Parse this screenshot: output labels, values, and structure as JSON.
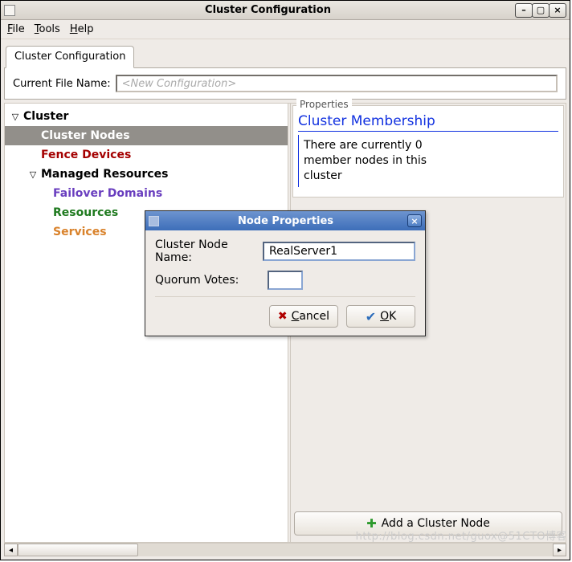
{
  "window": {
    "title": "Cluster Configuration"
  },
  "menubar": {
    "file": "File",
    "tools": "Tools",
    "help": "Help"
  },
  "notebook": {
    "tab_label": "Cluster Configuration",
    "current_file_label": "Current File Name:",
    "current_file_placeholder": "<New Configuration>"
  },
  "tree": {
    "cluster": "Cluster",
    "cluster_nodes": "Cluster Nodes",
    "fence_devices": "Fence Devices",
    "managed_resources": "Managed Resources",
    "failover_domains": "Failover Domains",
    "resources": "Resources",
    "services": "Services"
  },
  "properties": {
    "legend": "Properties",
    "title": "Cluster Membership",
    "body": "There are currently 0 member nodes in this cluster"
  },
  "add_button": {
    "label": "Add a Cluster Node"
  },
  "dialog": {
    "title": "Node Properties",
    "node_name_label": "Cluster Node Name:",
    "node_name_value": "RealServer1",
    "quorum_label": "Quorum Votes:",
    "quorum_value": "",
    "cancel": "Cancel",
    "ok": "OK"
  },
  "watermark": "http://blog.csdn.net/guox@51CTO博客"
}
